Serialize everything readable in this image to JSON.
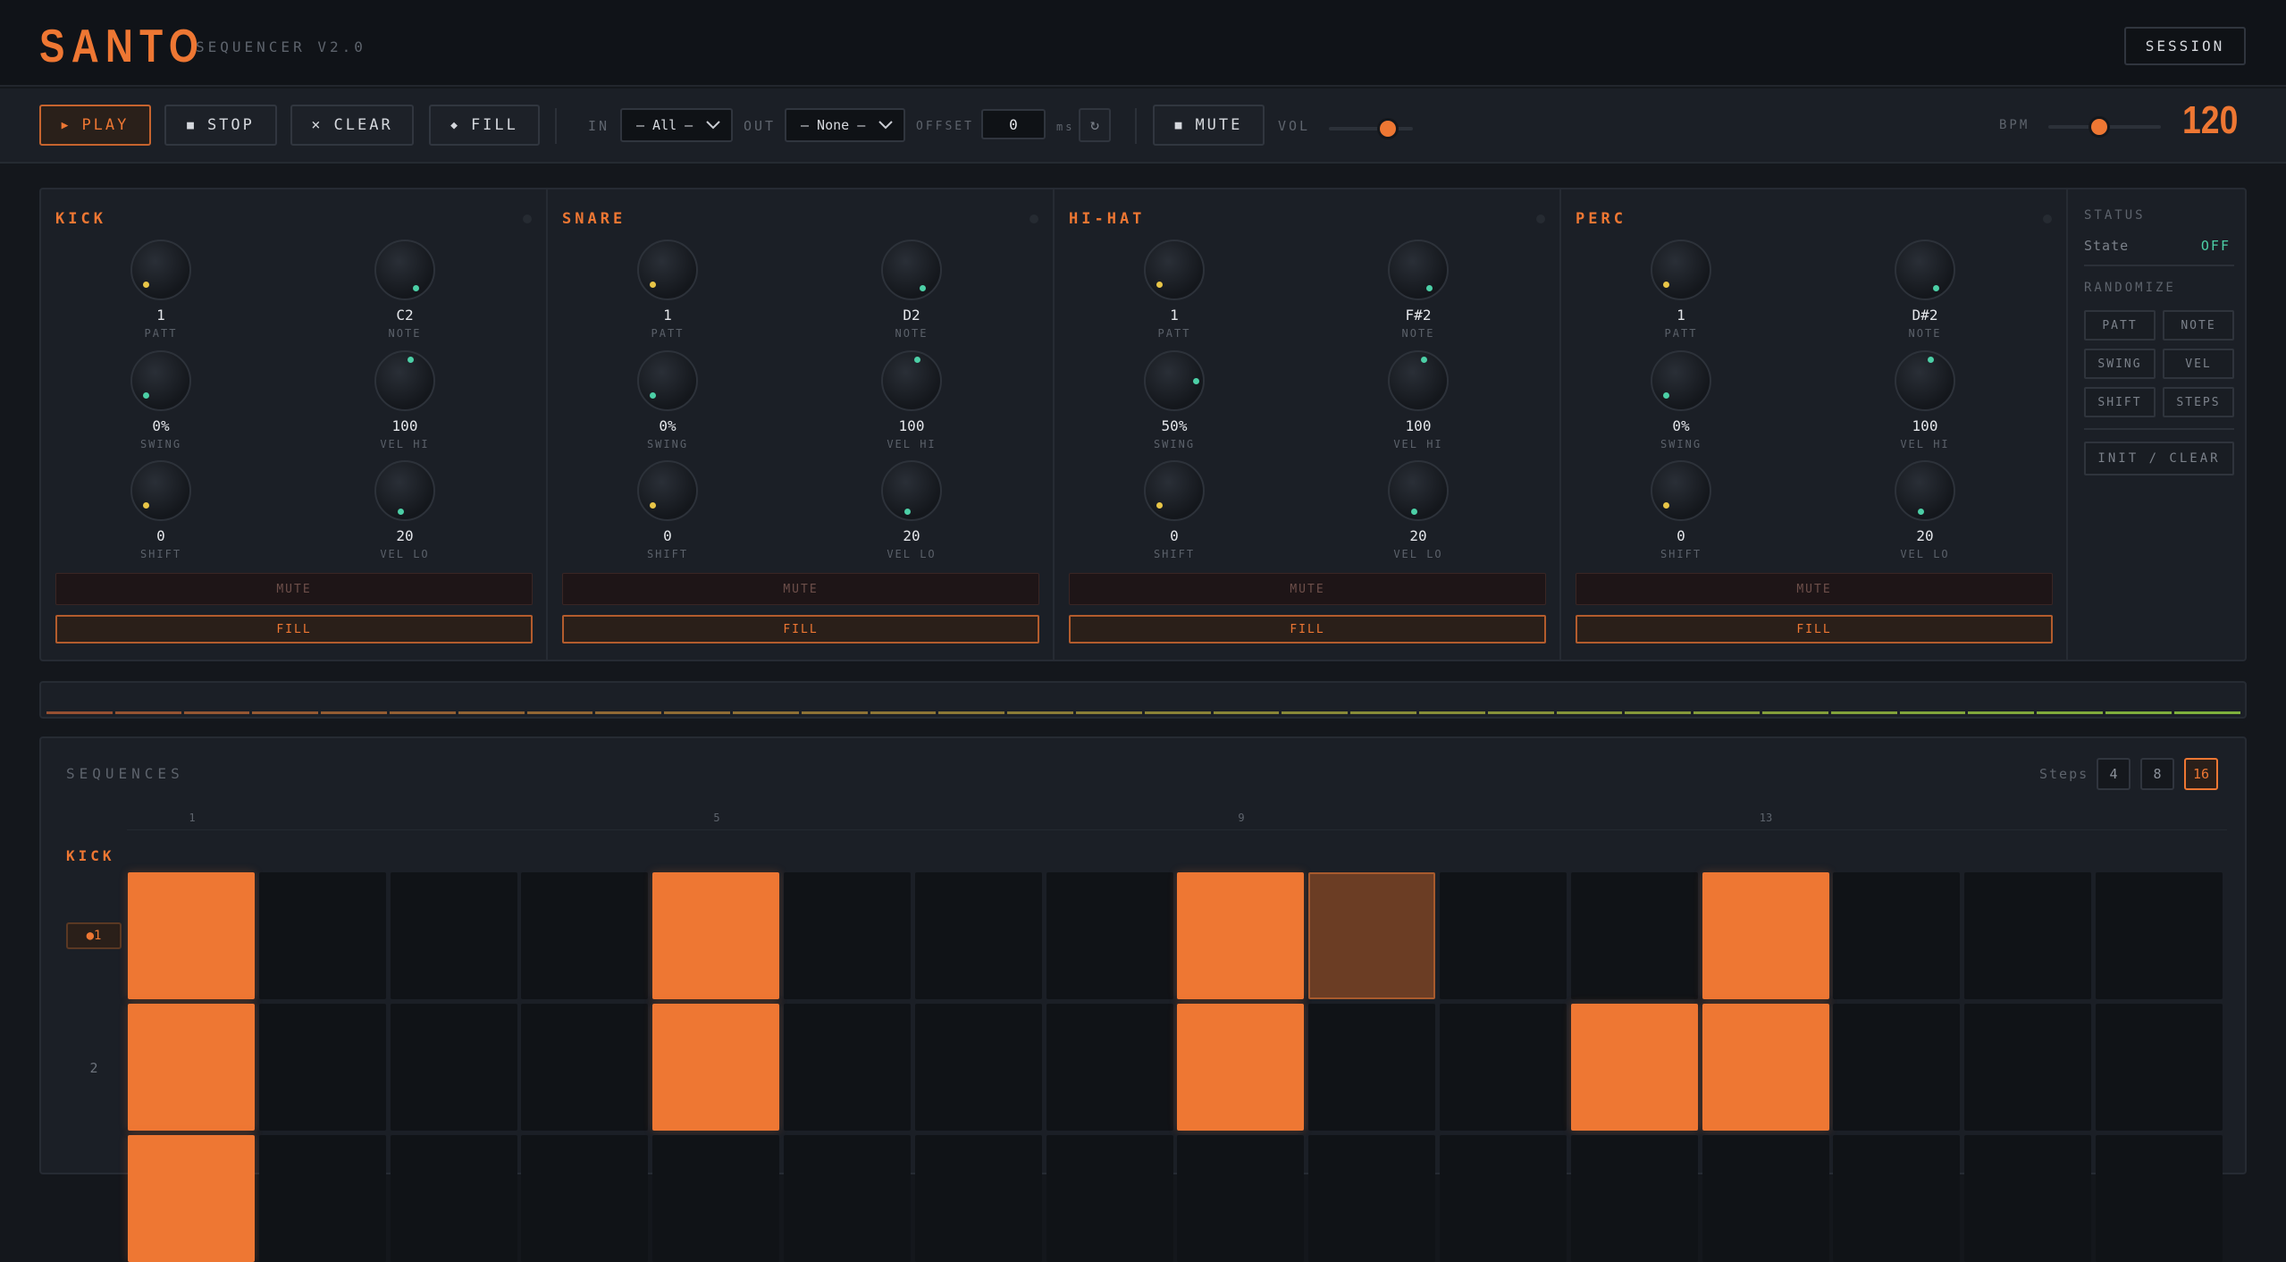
{
  "header": {
    "logo": "SANTO",
    "subtitle": "SEQUENCER V2.0",
    "session_label": "SESSION"
  },
  "transport": {
    "play_label": "PLAY",
    "play_icon": "▶",
    "stop_label": "STOP",
    "stop_icon": "■",
    "clear_label": "CLEAR",
    "clear_icon": "×",
    "fill_label": "FILL",
    "fill_icon": "◆",
    "in_label": "IN",
    "in_value": "– All –",
    "out_label": "OUT",
    "out_value": "– None –",
    "offset_label": "OFFSET",
    "offset_value": "0",
    "offset_unit": "ms",
    "refresh_icon": "↻",
    "mute_label": "MUTE",
    "mute_icon": "■",
    "vol_label": "VOL",
    "vol_level": 0.7,
    "bpm_label": "BPM",
    "bpm_value": "120",
    "bpm_level": 0.45
  },
  "tracks": [
    {
      "name": "KICK",
      "knobs": [
        {
          "value": "1",
          "label": "PATT",
          "color": "yellow"
        },
        {
          "value": "C2",
          "label": "NOTE",
          "color": "teal"
        },
        {
          "value": "0%",
          "label": "SWING",
          "color": "teal"
        },
        {
          "value": "100",
          "label": "VEL HI",
          "color": "teal"
        },
        {
          "value": "0",
          "label": "SHIFT",
          "color": "yellow"
        },
        {
          "value": "20",
          "label": "VEL LO",
          "color": "teal"
        }
      ],
      "mute_label": "MUTE",
      "fill_label": "FILL"
    },
    {
      "name": "SNARE",
      "knobs": [
        {
          "value": "1",
          "label": "PATT",
          "color": "yellow"
        },
        {
          "value": "D2",
          "label": "NOTE",
          "color": "teal"
        },
        {
          "value": "0%",
          "label": "SWING",
          "color": "teal"
        },
        {
          "value": "100",
          "label": "VEL HI",
          "color": "teal"
        },
        {
          "value": "0",
          "label": "SHIFT",
          "color": "yellow"
        },
        {
          "value": "20",
          "label": "VEL LO",
          "color": "teal"
        }
      ],
      "mute_label": "MUTE",
      "fill_label": "FILL"
    },
    {
      "name": "HI-HAT",
      "knobs": [
        {
          "value": "1",
          "label": "PATT",
          "color": "yellow"
        },
        {
          "value": "F#2",
          "label": "NOTE",
          "color": "teal"
        },
        {
          "value": "50%",
          "label": "SWING",
          "color": "teal"
        },
        {
          "value": "100",
          "label": "VEL HI",
          "color": "teal"
        },
        {
          "value": "0",
          "label": "SHIFT",
          "color": "yellow"
        },
        {
          "value": "20",
          "label": "VEL LO",
          "color": "teal"
        }
      ],
      "mute_label": "MUTE",
      "fill_label": "FILL"
    },
    {
      "name": "PERC",
      "knobs": [
        {
          "value": "1",
          "label": "PATT",
          "color": "yellow"
        },
        {
          "value": "D#2",
          "label": "NOTE",
          "color": "teal"
        },
        {
          "value": "0%",
          "label": "SWING",
          "color": "teal"
        },
        {
          "value": "100",
          "label": "VEL HI",
          "color": "teal"
        },
        {
          "value": "0",
          "label": "SHIFT",
          "color": "yellow"
        },
        {
          "value": "20",
          "label": "VEL LO",
          "color": "teal"
        }
      ],
      "mute_label": "MUTE",
      "fill_label": "FILL"
    }
  ],
  "status": {
    "title": "STATUS",
    "state_label": "State",
    "state_value": "OFF",
    "randomize_title": "RANDOMIZE",
    "randomize_buttons": [
      "PATT",
      "NOTE",
      "SWING",
      "VEL",
      "SHIFT",
      "STEPS"
    ],
    "init_label": "INIT / CLEAR"
  },
  "sequences": {
    "title": "SEQUENCES",
    "steps_label": "Steps",
    "step_options": [
      "4",
      "8",
      "16"
    ],
    "active_steps": "16",
    "step_numbers": [
      "1",
      "5",
      "9",
      "13"
    ],
    "track_name": "KICK",
    "rows": [
      {
        "label": "●1",
        "cells": [
          1,
          0,
          0,
          0,
          1,
          0,
          0,
          0,
          1,
          2,
          0,
          0,
          1,
          0,
          0,
          0
        ]
      },
      {
        "label": "2",
        "cells": [
          1,
          0,
          0,
          0,
          1,
          0,
          0,
          0,
          1,
          0,
          0,
          1,
          1,
          0,
          0,
          0
        ]
      },
      {
        "label": "",
        "cells": [
          1,
          0,
          0,
          0,
          0,
          0,
          0,
          0,
          0,
          0,
          0,
          0,
          0,
          0,
          0,
          0
        ]
      }
    ]
  },
  "colors": {
    "accent": "#ee7733",
    "teal": "#4ccfa6",
    "yellow": "#e8c547",
    "background": "#14171c"
  }
}
